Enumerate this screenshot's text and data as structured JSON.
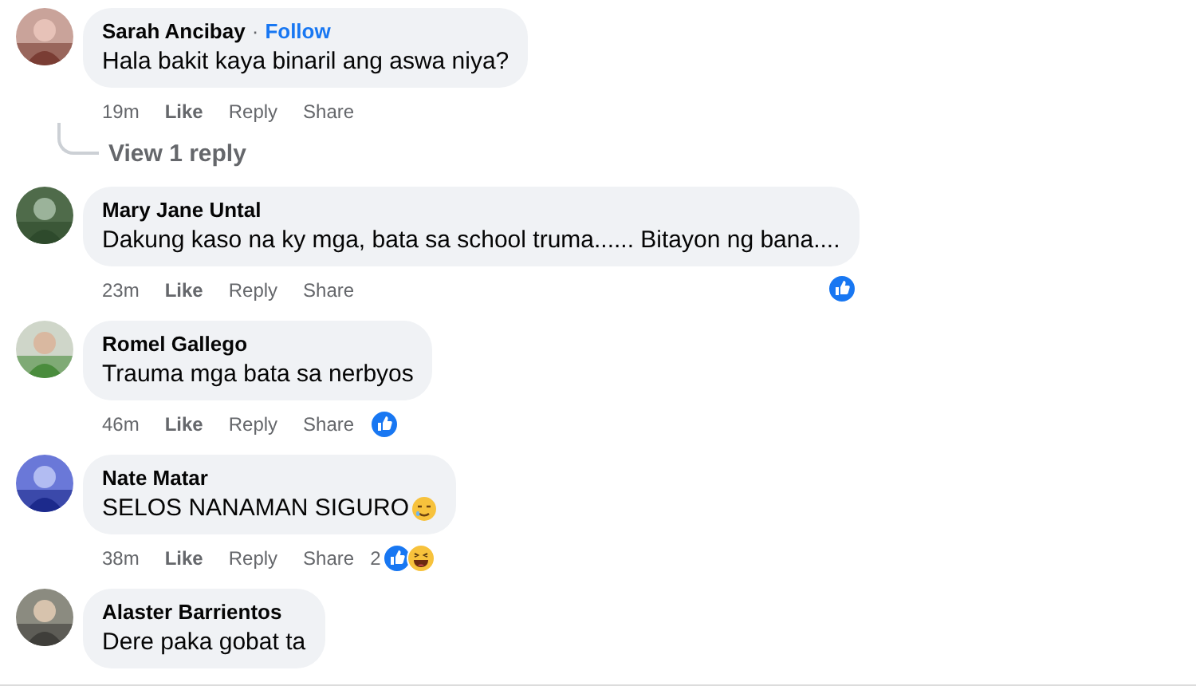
{
  "comments": [
    {
      "author": "Sarah Ancibay",
      "separator": "·",
      "follow": "Follow",
      "text": "Hala bakit kaya binaril ang aswa niya?",
      "time": "19m",
      "actions": [
        "Like",
        "Reply",
        "Share"
      ],
      "view_replies": "View 1 reply"
    },
    {
      "author": "Mary Jane Untal",
      "text": "Dakung kaso na ky mga, bata sa school truma...... Bitayon ng bana....",
      "time": "23m",
      "actions": [
        "Like",
        "Reply",
        "Share"
      ],
      "reactions": {
        "at_bubble_edge": true,
        "items": [
          {
            "kind": "like"
          }
        ]
      }
    },
    {
      "author": "Romel Gallego",
      "text": "Trauma mga bata sa nerbyos",
      "time": "46m",
      "actions": [
        "Like",
        "Reply",
        "Share"
      ],
      "reactions": {
        "at_bubble_edge": false,
        "items": [
          {
            "kind": "like"
          }
        ]
      }
    },
    {
      "author": "Nate Matar",
      "text": "SELOS NANAMAN SIGURO",
      "trailing_icon": {
        "kind": "smiling-tear"
      },
      "time": "38m",
      "actions": [
        "Like",
        "Reply",
        "Share"
      ],
      "reactions": {
        "at_bubble_edge": false,
        "count": "2",
        "items": [
          {
            "kind": "like"
          },
          {
            "kind": "haha"
          }
        ]
      }
    },
    {
      "author": "Alaster Barrientos",
      "text": "Dere paka gobat ta"
    }
  ]
}
